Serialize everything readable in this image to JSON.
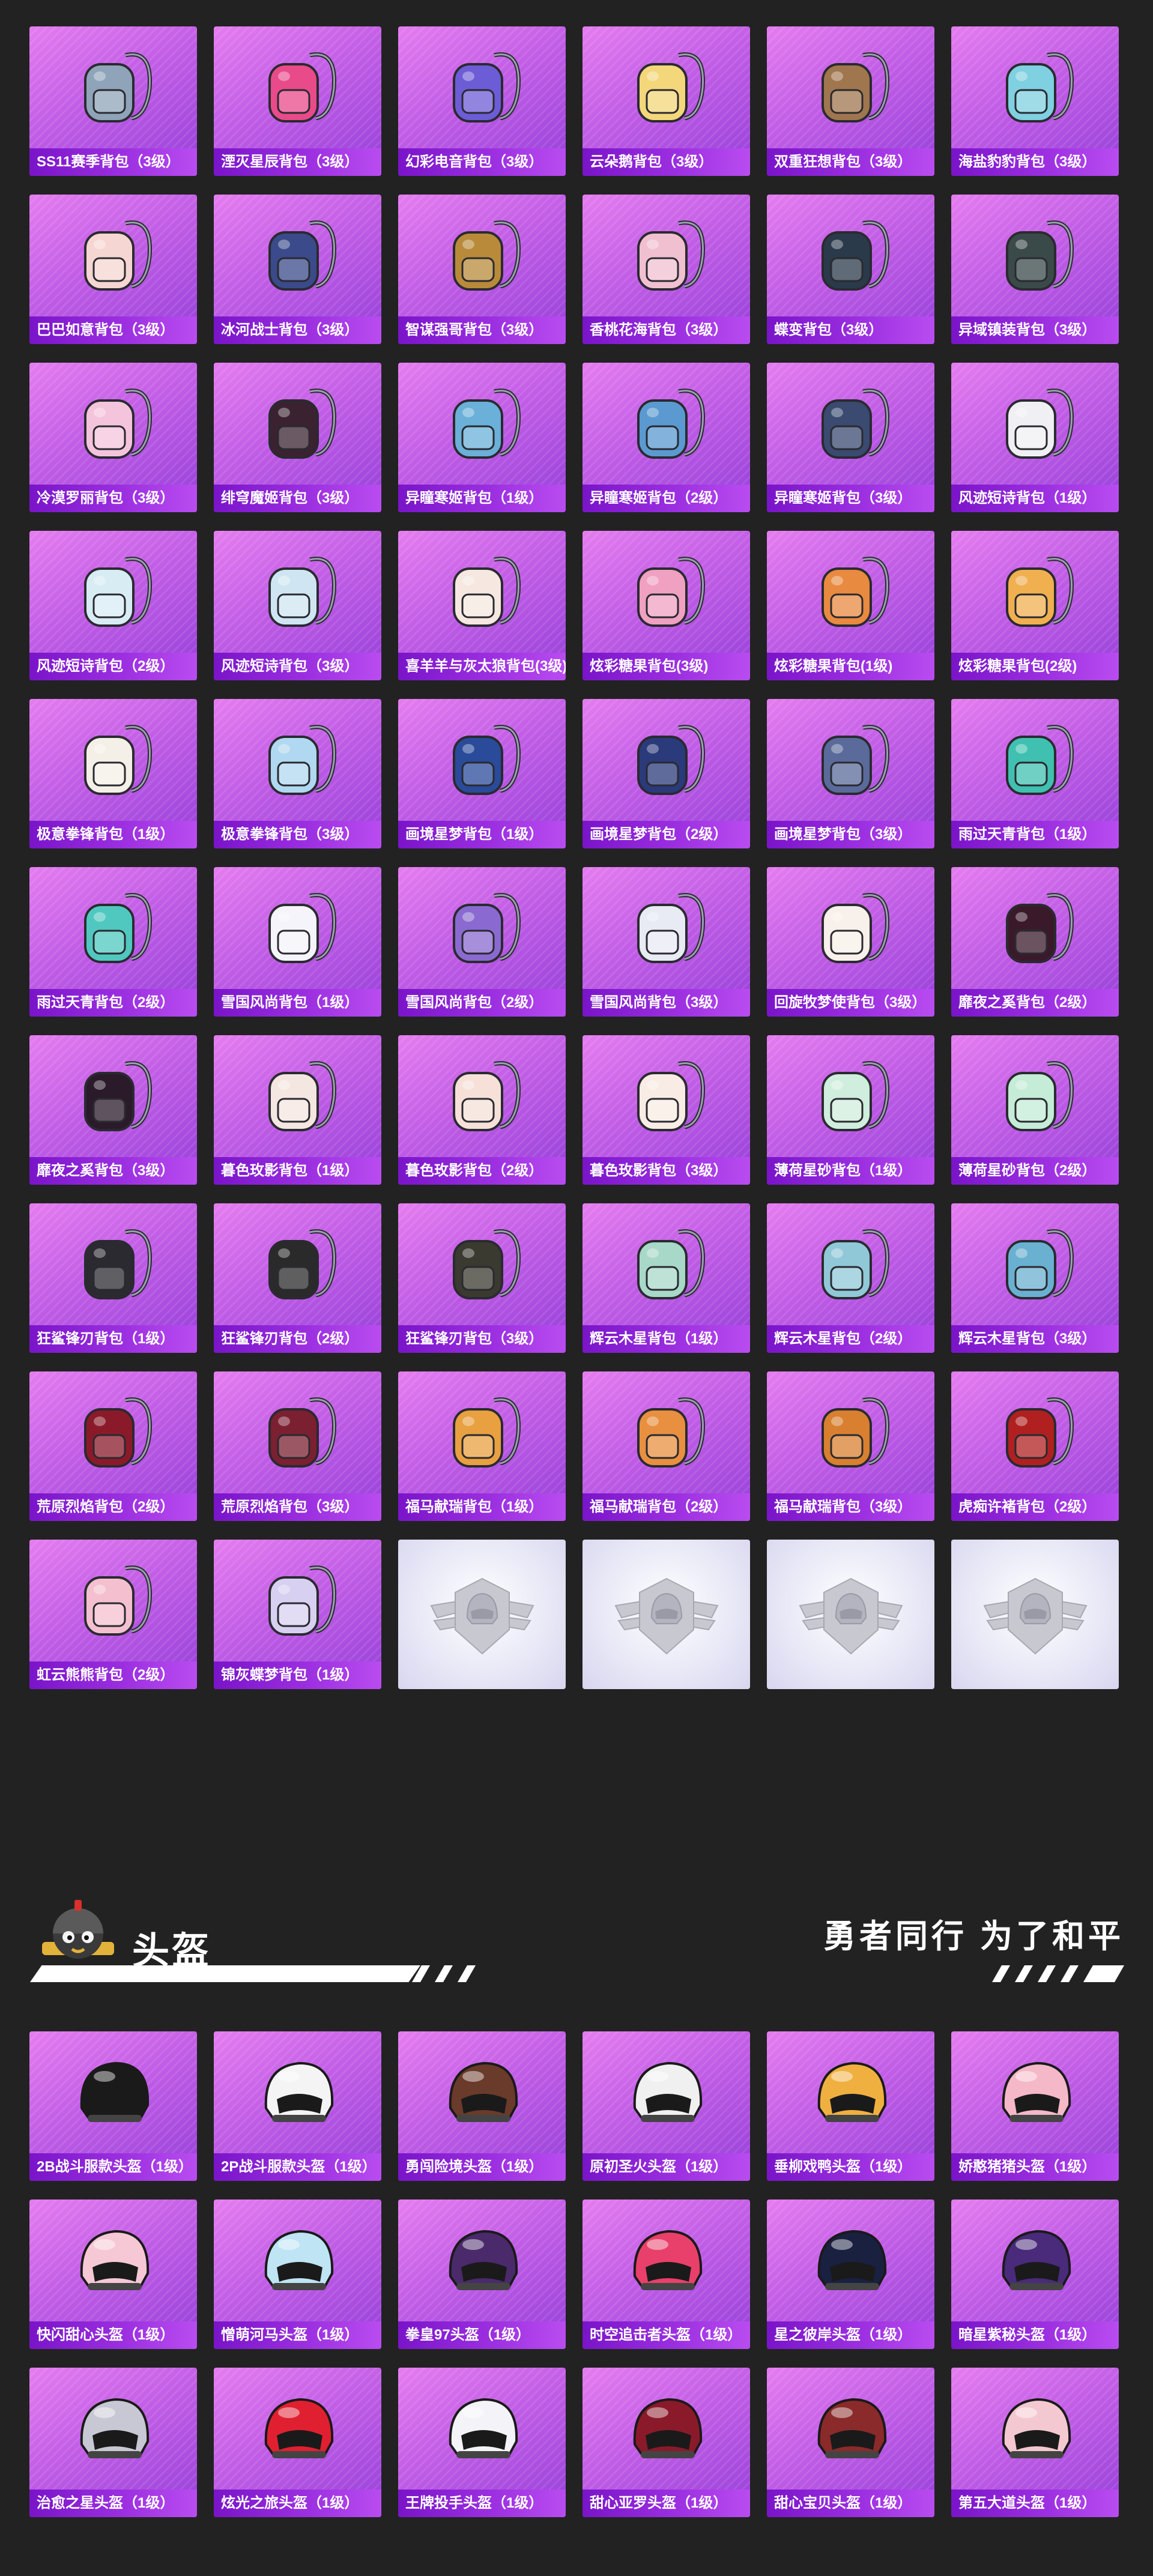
{
  "backpacks": [
    {
      "name": "SS11赛季背包（3级）",
      "icon": "backpack-icon",
      "color": "#8fa4b8"
    },
    {
      "name": "湮灭星辰背包（3级）",
      "icon": "backpack-icon",
      "color": "#e84a8a"
    },
    {
      "name": "幻彩电音背包（3级）",
      "icon": "backpack-icon",
      "color": "#6c5cd6"
    },
    {
      "name": "云朵鹅背包（3级）",
      "icon": "backpack-icon",
      "color": "#f3d77a"
    },
    {
      "name": "双重狂想背包（3级）",
      "icon": "backpack-icon",
      "color": "#a0764e"
    },
    {
      "name": "海盐豹豹背包（3级）",
      "icon": "backpack-icon",
      "color": "#7fd0e0"
    },
    {
      "name": "巴巴如意背包（3级）",
      "icon": "backpack-icon",
      "color": "#f6d6d2"
    },
    {
      "name": "冰河战士背包（3级）",
      "icon": "backpack-icon",
      "color": "#3a4a8a"
    },
    {
      "name": "智谋强哥背包（3级）",
      "icon": "backpack-icon",
      "color": "#b88a3a"
    },
    {
      "name": "香桃花海背包（3级）",
      "icon": "backpack-icon",
      "color": "#f0c0d0"
    },
    {
      "name": "蝶变背包（3级）",
      "icon": "backpack-icon",
      "color": "#2a3a4a"
    },
    {
      "name": "异域镇装背包（3级）",
      "icon": "backpack-icon",
      "color": "#3a4a48"
    },
    {
      "name": "冷漠罗丽背包（3级）",
      "icon": "backpack-icon",
      "color": "#f4c4dc"
    },
    {
      "name": "绯穹魔姬背包（3级）",
      "icon": "backpack-icon",
      "color": "#3a2230"
    },
    {
      "name": "异瞳寒姬背包（1级）",
      "icon": "backpack-icon",
      "color": "#6ab0d8"
    },
    {
      "name": "异瞳寒姬背包（2级）",
      "icon": "backpack-icon",
      "color": "#5a9ad0"
    },
    {
      "name": "异瞳寒姬背包（3级）",
      "icon": "backpack-icon",
      "color": "#3a4a70"
    },
    {
      "name": "风迹短诗背包（1级）",
      "icon": "backpack-icon",
      "color": "#f0f0f4"
    },
    {
      "name": "风迹短诗背包（2级）",
      "icon": "backpack-icon",
      "color": "#d8ecf4"
    },
    {
      "name": "风迹短诗背包（3级）",
      "icon": "backpack-icon",
      "color": "#cfe6f2"
    },
    {
      "name": "喜羊羊与灰太狼背包(3级)",
      "icon": "backpack-icon",
      "color": "#f6e8e0"
    },
    {
      "name": "炫彩糖果背包(3级)",
      "icon": "backpack-icon",
      "color": "#f0a0c0"
    },
    {
      "name": "炫彩糖果背包(1级)",
      "icon": "backpack-icon",
      "color": "#e88a40"
    },
    {
      "name": "炫彩糖果背包(2级)",
      "icon": "backpack-icon",
      "color": "#f0b050"
    },
    {
      "name": "极意拳锋背包（1级）",
      "icon": "backpack-icon",
      "color": "#f4f0e8"
    },
    {
      "name": "极意拳锋背包（3级）",
      "icon": "backpack-icon",
      "color": "#b0d8f0"
    },
    {
      "name": "画境星梦背包（1级）",
      "icon": "backpack-icon",
      "color": "#2a4a9a"
    },
    {
      "name": "画境星梦背包（2级）",
      "icon": "backpack-icon",
      "color": "#2a3a7a"
    },
    {
      "name": "画境星梦背包（3级）",
      "icon": "backpack-icon",
      "color": "#5a6a9a"
    },
    {
      "name": "雨过天青背包（1级）",
      "icon": "backpack-icon",
      "color": "#40c0b0"
    },
    {
      "name": "雨过天青背包（2级）",
      "icon": "backpack-icon",
      "color": "#50c8c0"
    },
    {
      "name": "雪国风尚背包（1级）",
      "icon": "backpack-icon",
      "color": "#f4f4fa"
    },
    {
      "name": "雪国风尚背包（2级）",
      "icon": "backpack-icon",
      "color": "#8a6ad0"
    },
    {
      "name": "雪国风尚背包（3级）",
      "icon": "backpack-icon",
      "color": "#e8eaf4"
    },
    {
      "name": "回旋牧梦使背包（3级）",
      "icon": "backpack-icon",
      "color": "#f8f0ea"
    },
    {
      "name": "靡夜之奚背包（2级）",
      "icon": "backpack-icon",
      "color": "#3a1a2a"
    },
    {
      "name": "靡夜之奚背包（3级）",
      "icon": "backpack-icon",
      "color": "#2a1a2a"
    },
    {
      "name": "暮色玫影背包（1级）",
      "icon": "backpack-icon",
      "color": "#f4e6e0"
    },
    {
      "name": "暮色玫影背包（2级）",
      "icon": "backpack-icon",
      "color": "#f6e0d8"
    },
    {
      "name": "暮色玫影背包（3级）",
      "icon": "backpack-icon",
      "color": "#f8ece4"
    },
    {
      "name": "薄荷星砂背包（1级）",
      "icon": "backpack-icon",
      "color": "#cfeedd"
    },
    {
      "name": "薄荷星砂背包（2级）",
      "icon": "backpack-icon",
      "color": "#c4ecd6"
    },
    {
      "name": "狂鲨锋刃背包（1级）",
      "icon": "backpack-icon",
      "color": "#2a2a30"
    },
    {
      "name": "狂鲨锋刃背包（2级）",
      "icon": "backpack-icon",
      "color": "#2a2a2a"
    },
    {
      "name": "狂鲨锋刃背包（3级）",
      "icon": "backpack-icon",
      "color": "#3a3a30"
    },
    {
      "name": "辉云木星背包（1级）",
      "icon": "backpack-icon",
      "color": "#a8d8c8"
    },
    {
      "name": "辉云木星背包（2级）",
      "icon": "backpack-icon",
      "color": "#90c8d8"
    },
    {
      "name": "辉云木星背包（3级）",
      "icon": "backpack-icon",
      "color": "#6ab0d0"
    },
    {
      "name": "荒原烈焰背包（2级）",
      "icon": "backpack-icon",
      "color": "#8a1a2a"
    },
    {
      "name": "荒原烈焰背包（3级）",
      "icon": "backpack-icon",
      "color": "#7a2030"
    },
    {
      "name": "福马献瑞背包（1级）",
      "icon": "backpack-icon",
      "color": "#e8a040"
    },
    {
      "name": "福马献瑞背包（2级）",
      "icon": "backpack-icon",
      "color": "#e89040"
    },
    {
      "name": "福马献瑞背包（3级）",
      "icon": "backpack-icon",
      "color": "#d88030"
    },
    {
      "name": "虎痴许褚背包（2级）",
      "icon": "backpack-icon",
      "color": "#b02020"
    },
    {
      "name": "虹云熊熊背包（2级）",
      "icon": "backpack-icon",
      "color": "#f4c0d0"
    },
    {
      "name": "锦灰蝶梦背包（1级）",
      "icon": "backpack-icon",
      "color": "#d8d0f0"
    }
  ],
  "empty_slots": 4,
  "helmet_section": {
    "title": "头盔",
    "slogan": "勇者同行 为了和平",
    "icon": "helmet-mascot-icon"
  },
  "helmets": [
    {
      "name": "2B战斗服款头盔（1级）",
      "icon": "helmet-icon",
      "color": "#1a1a1a"
    },
    {
      "name": "2P战斗服款头盔（1级）",
      "icon": "helmet-icon",
      "color": "#f4f4f4"
    },
    {
      "name": "勇闯险境头盔（1级）",
      "icon": "helmet-icon",
      "color": "#6a3a2a"
    },
    {
      "name": "原初圣火头盔（1级）",
      "icon": "helmet-icon",
      "color": "#f0f0f0"
    },
    {
      "name": "垂柳戏鸭头盔（1级）",
      "icon": "helmet-icon",
      "color": "#f0b040"
    },
    {
      "name": "娇憨猪猪头盔（1级）",
      "icon": "helmet-icon",
      "color": "#f4b8c8"
    },
    {
      "name": "快闪甜心头盔（1级）",
      "icon": "helmet-icon",
      "color": "#f6c8d6"
    },
    {
      "name": "憎萌河马头盔（1级）",
      "icon": "helmet-icon",
      "color": "#bfe4f4"
    },
    {
      "name": "拳皇97头盔（1级）",
      "icon": "helmet-icon",
      "color": "#4a2a6a"
    },
    {
      "name": "时空追击者头盔（1级）",
      "icon": "helmet-icon",
      "color": "#e8406a"
    },
    {
      "name": "星之彼岸头盔（1级）",
      "icon": "helmet-icon",
      "color": "#1a2040"
    },
    {
      "name": "暗星紫秘头盔（1级）",
      "icon": "helmet-icon",
      "color": "#4a2a7a"
    },
    {
      "name": "治愈之星头盔（1级）",
      "icon": "helmet-icon",
      "color": "#c8c8d4"
    },
    {
      "name": "炫光之旅头盔（1级）",
      "icon": "helmet-icon",
      "color": "#e02030"
    },
    {
      "name": "王牌投手头盔（1级）",
      "icon": "helmet-icon",
      "color": "#f4f4f8"
    },
    {
      "name": "甜心亚罗头盔（1级）",
      "icon": "helmet-icon",
      "color": "#8a1a2a"
    },
    {
      "name": "甜心宝贝头盔（1级）",
      "icon": "helmet-icon",
      "color": "#8a2a2a"
    },
    {
      "name": "第五大道头盔（1级）",
      "icon": "helmet-icon",
      "color": "#f4c8d0"
    }
  ]
}
